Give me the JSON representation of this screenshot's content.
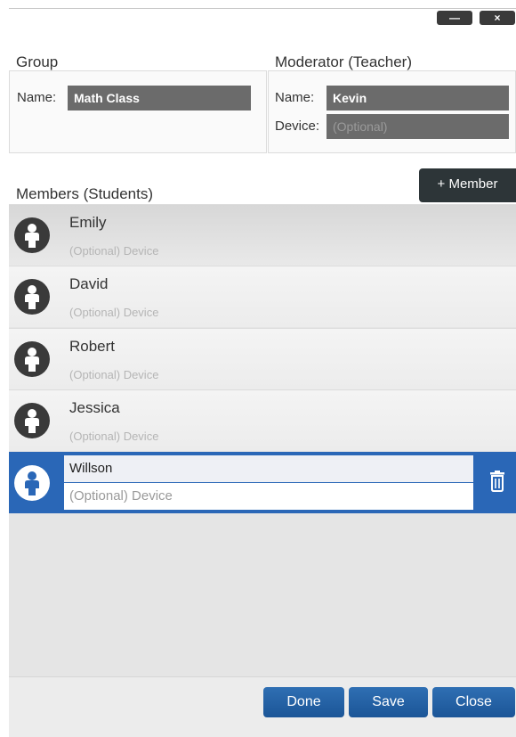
{
  "window": {
    "minimize_label": "—",
    "close_label": "×"
  },
  "group": {
    "title": "Group",
    "name_label": "Name:",
    "name_value": "Math Class"
  },
  "moderator": {
    "title": "Moderator (Teacher)",
    "name_label": "Name:",
    "name_value": "Kevin",
    "device_label": "Device:",
    "device_placeholder": "(Optional)"
  },
  "members": {
    "title": "Members (Students)",
    "add_button": "+ Member",
    "device_placeholder": "(Optional) Device",
    "items": [
      {
        "name": "Emily",
        "device": "(Optional) Device"
      },
      {
        "name": "David",
        "device": "(Optional) Device"
      },
      {
        "name": "Robert",
        "device": "(Optional) Device"
      },
      {
        "name": "Jessica",
        "device": "(Optional) Device"
      }
    ],
    "selected": {
      "name": "Willson",
      "device_placeholder": "(Optional) Device"
    }
  },
  "footer": {
    "done_label": "Done",
    "save_label": "Save",
    "close_label": "Close"
  },
  "colors": {
    "accent": "#2a67b7",
    "button_blue": "#1f5fa6",
    "dark_button": "#2d3538"
  },
  "icons": {
    "avatar": "person-icon",
    "delete": "trash-icon"
  }
}
